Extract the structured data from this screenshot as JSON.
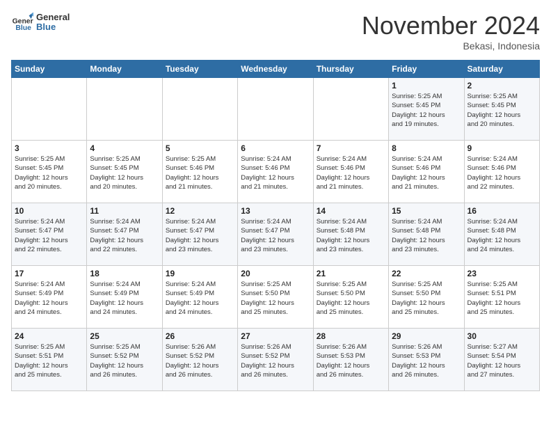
{
  "header": {
    "logo_line1": "General",
    "logo_line2": "Blue",
    "month": "November 2024",
    "location": "Bekasi, Indonesia"
  },
  "weekdays": [
    "Sunday",
    "Monday",
    "Tuesday",
    "Wednesday",
    "Thursday",
    "Friday",
    "Saturday"
  ],
  "weeks": [
    [
      {
        "day": "",
        "info": ""
      },
      {
        "day": "",
        "info": ""
      },
      {
        "day": "",
        "info": ""
      },
      {
        "day": "",
        "info": ""
      },
      {
        "day": "",
        "info": ""
      },
      {
        "day": "1",
        "info": "Sunrise: 5:25 AM\nSunset: 5:45 PM\nDaylight: 12 hours\nand 19 minutes."
      },
      {
        "day": "2",
        "info": "Sunrise: 5:25 AM\nSunset: 5:45 PM\nDaylight: 12 hours\nand 20 minutes."
      }
    ],
    [
      {
        "day": "3",
        "info": "Sunrise: 5:25 AM\nSunset: 5:45 PM\nDaylight: 12 hours\nand 20 minutes."
      },
      {
        "day": "4",
        "info": "Sunrise: 5:25 AM\nSunset: 5:45 PM\nDaylight: 12 hours\nand 20 minutes."
      },
      {
        "day": "5",
        "info": "Sunrise: 5:25 AM\nSunset: 5:46 PM\nDaylight: 12 hours\nand 21 minutes."
      },
      {
        "day": "6",
        "info": "Sunrise: 5:24 AM\nSunset: 5:46 PM\nDaylight: 12 hours\nand 21 minutes."
      },
      {
        "day": "7",
        "info": "Sunrise: 5:24 AM\nSunset: 5:46 PM\nDaylight: 12 hours\nand 21 minutes."
      },
      {
        "day": "8",
        "info": "Sunrise: 5:24 AM\nSunset: 5:46 PM\nDaylight: 12 hours\nand 21 minutes."
      },
      {
        "day": "9",
        "info": "Sunrise: 5:24 AM\nSunset: 5:46 PM\nDaylight: 12 hours\nand 22 minutes."
      }
    ],
    [
      {
        "day": "10",
        "info": "Sunrise: 5:24 AM\nSunset: 5:47 PM\nDaylight: 12 hours\nand 22 minutes."
      },
      {
        "day": "11",
        "info": "Sunrise: 5:24 AM\nSunset: 5:47 PM\nDaylight: 12 hours\nand 22 minutes."
      },
      {
        "day": "12",
        "info": "Sunrise: 5:24 AM\nSunset: 5:47 PM\nDaylight: 12 hours\nand 23 minutes."
      },
      {
        "day": "13",
        "info": "Sunrise: 5:24 AM\nSunset: 5:47 PM\nDaylight: 12 hours\nand 23 minutes."
      },
      {
        "day": "14",
        "info": "Sunrise: 5:24 AM\nSunset: 5:48 PM\nDaylight: 12 hours\nand 23 minutes."
      },
      {
        "day": "15",
        "info": "Sunrise: 5:24 AM\nSunset: 5:48 PM\nDaylight: 12 hours\nand 23 minutes."
      },
      {
        "day": "16",
        "info": "Sunrise: 5:24 AM\nSunset: 5:48 PM\nDaylight: 12 hours\nand 24 minutes."
      }
    ],
    [
      {
        "day": "17",
        "info": "Sunrise: 5:24 AM\nSunset: 5:49 PM\nDaylight: 12 hours\nand 24 minutes."
      },
      {
        "day": "18",
        "info": "Sunrise: 5:24 AM\nSunset: 5:49 PM\nDaylight: 12 hours\nand 24 minutes."
      },
      {
        "day": "19",
        "info": "Sunrise: 5:24 AM\nSunset: 5:49 PM\nDaylight: 12 hours\nand 24 minutes."
      },
      {
        "day": "20",
        "info": "Sunrise: 5:25 AM\nSunset: 5:50 PM\nDaylight: 12 hours\nand 25 minutes."
      },
      {
        "day": "21",
        "info": "Sunrise: 5:25 AM\nSunset: 5:50 PM\nDaylight: 12 hours\nand 25 minutes."
      },
      {
        "day": "22",
        "info": "Sunrise: 5:25 AM\nSunset: 5:50 PM\nDaylight: 12 hours\nand 25 minutes."
      },
      {
        "day": "23",
        "info": "Sunrise: 5:25 AM\nSunset: 5:51 PM\nDaylight: 12 hours\nand 25 minutes."
      }
    ],
    [
      {
        "day": "24",
        "info": "Sunrise: 5:25 AM\nSunset: 5:51 PM\nDaylight: 12 hours\nand 25 minutes."
      },
      {
        "day": "25",
        "info": "Sunrise: 5:25 AM\nSunset: 5:52 PM\nDaylight: 12 hours\nand 26 minutes."
      },
      {
        "day": "26",
        "info": "Sunrise: 5:26 AM\nSunset: 5:52 PM\nDaylight: 12 hours\nand 26 minutes."
      },
      {
        "day": "27",
        "info": "Sunrise: 5:26 AM\nSunset: 5:52 PM\nDaylight: 12 hours\nand 26 minutes."
      },
      {
        "day": "28",
        "info": "Sunrise: 5:26 AM\nSunset: 5:53 PM\nDaylight: 12 hours\nand 26 minutes."
      },
      {
        "day": "29",
        "info": "Sunrise: 5:26 AM\nSunset: 5:53 PM\nDaylight: 12 hours\nand 26 minutes."
      },
      {
        "day": "30",
        "info": "Sunrise: 5:27 AM\nSunset: 5:54 PM\nDaylight: 12 hours\nand 27 minutes."
      }
    ]
  ]
}
